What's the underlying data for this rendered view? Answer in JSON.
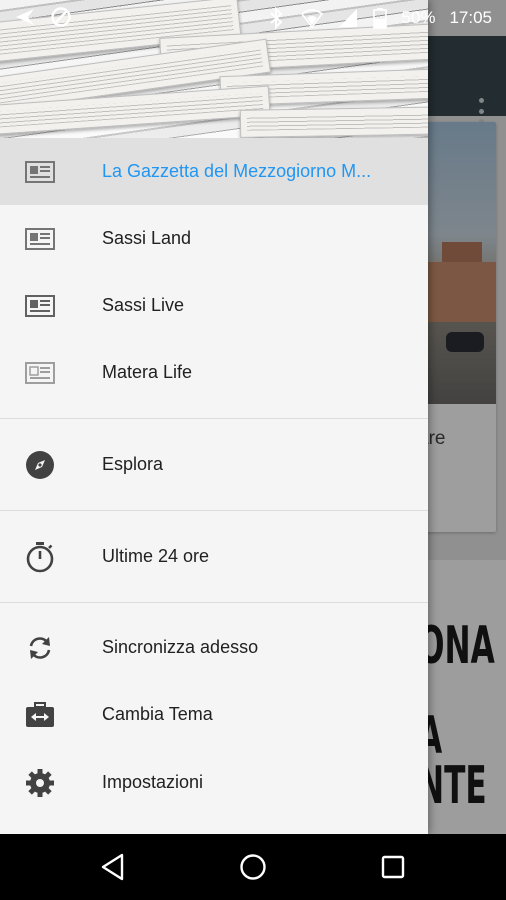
{
  "status_bar": {
    "battery_percent": "50%",
    "time": "17:05",
    "icons": [
      "cast-icon",
      "no-entry-icon",
      "bluetooth-icon",
      "wifi-icon",
      "cell-signal-icon",
      "battery-icon"
    ]
  },
  "background": {
    "card_text": "are",
    "banner_lines": [
      "ONA",
      "A",
      "NTE"
    ]
  },
  "drawer": {
    "items": [
      {
        "label": "La Gazzetta del Mezzogiorno M...",
        "icon": "newspaper-icon",
        "active": true
      },
      {
        "label": "Sassi Land",
        "icon": "newspaper-icon",
        "active": false
      },
      {
        "label": "Sassi Live",
        "icon": "newspaper-icon",
        "active": false
      },
      {
        "label": "Matera Life",
        "icon": "newspaper-icon",
        "active": false
      }
    ],
    "explore": {
      "label": "Esplora",
      "icon": "compass-icon"
    },
    "last24": {
      "label": "Ultime 24 ore",
      "icon": "timer-icon"
    },
    "actions": [
      {
        "label": "Sincronizza adesso",
        "icon": "sync-icon"
      },
      {
        "label": "Cambia Tema",
        "icon": "theme-icon"
      },
      {
        "label": "Impostazioni",
        "icon": "gear-icon"
      }
    ]
  },
  "colors": {
    "accent": "#2196f3",
    "toolbar": "#37474f",
    "drawer_bg": "#f5f5f5",
    "active_bg": "#e0e0e0"
  }
}
